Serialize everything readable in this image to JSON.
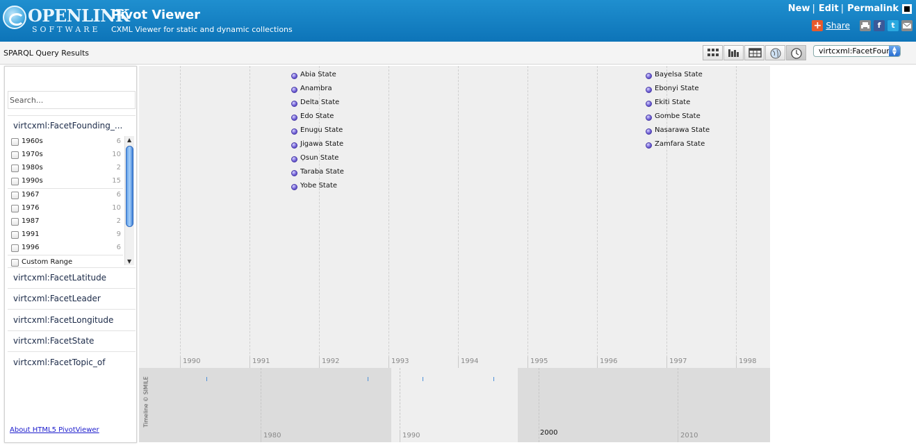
{
  "header": {
    "logo_main": "OPENLINK",
    "logo_sub": "SOFTWARE",
    "title": "Pivot Viewer",
    "subtitle": "CXML Viewer for static and dynamic collections",
    "nav": {
      "new": "New",
      "edit": "Edit",
      "permalink": "Permalink",
      "sep": "|"
    },
    "share": {
      "plus": "+",
      "label": "Share"
    },
    "social": {
      "facebook": "f",
      "twitter": "t"
    }
  },
  "toolbar": {
    "results_label": "SPARQL Query Results",
    "views": [
      {
        "name": "grid-view-icon",
        "active": false
      },
      {
        "name": "bar-chart-view-icon",
        "active": false
      },
      {
        "name": "table-view-icon",
        "active": false
      },
      {
        "name": "map-view-icon",
        "active": false
      },
      {
        "name": "timeline-view-icon",
        "active": true
      }
    ],
    "facet_select": {
      "selected": "virtcxml:FacetFounding_date"
    }
  },
  "sidebar": {
    "search_placeholder": "Search...",
    "founding_facet": {
      "title": "virtcxml:FacetFounding_...",
      "decades": [
        {
          "label": "1960s",
          "count": "6"
        },
        {
          "label": "1970s",
          "count": "10"
        },
        {
          "label": "1980s",
          "count": "2"
        },
        {
          "label": "1990s",
          "count": "15"
        }
      ],
      "years": [
        {
          "label": "1967",
          "count": "6"
        },
        {
          "label": "1976",
          "count": "10"
        },
        {
          "label": "1987",
          "count": "2"
        },
        {
          "label": "1991",
          "count": "9"
        },
        {
          "label": "1996",
          "count": "6"
        }
      ],
      "custom_range": "Custom Range"
    },
    "other_facets": [
      "virtcxml:FacetLatitude",
      "virtcxml:FacetLeader",
      "virtcxml:FacetLongitude",
      "virtcxml:FacetState",
      "virtcxml:FacetTopic_of"
    ],
    "about_link": "About HTML5 PivotViewer"
  },
  "timeline": {
    "years": [
      "1990",
      "1991",
      "1992",
      "1993",
      "1994",
      "1995",
      "1996",
      "1997",
      "1998"
    ],
    "events_1991": [
      "Abia State",
      "Anambra",
      "Delta State",
      "Edo State",
      "Enugu State",
      "Jigawa State",
      "Ọsun State",
      "Taraba State",
      "Yobe State"
    ],
    "events_1996": [
      "Bayelsa State",
      "Ebonyi State",
      "Ekiti State",
      "Gombe State",
      "Nasarawa State",
      "Zamfara State"
    ]
  },
  "overview": {
    "labels": {
      "l1980": "1980",
      "l1990": "1990",
      "l2000": "2000",
      "l2010": "2010"
    },
    "credit": "Timeline © SIMILE"
  },
  "colors": {
    "header": "#0d74b8",
    "event_dot": "#7565d8",
    "link": "#1a1acc"
  }
}
